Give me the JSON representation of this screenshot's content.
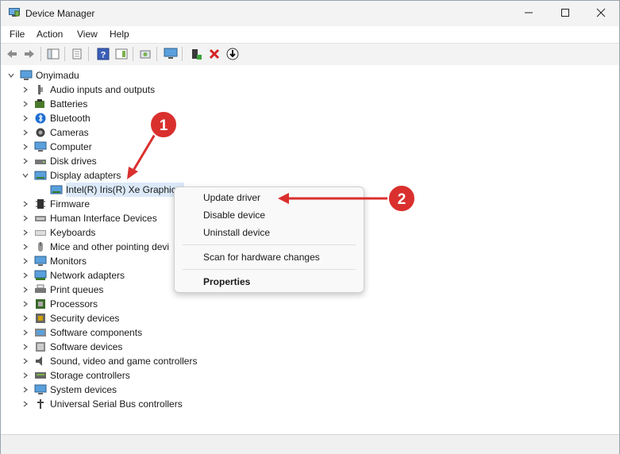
{
  "window": {
    "title": "Device Manager",
    "minimize": "—",
    "maximize": "☐",
    "close": "✕"
  },
  "menu": [
    "File",
    "Action",
    "View",
    "Help"
  ],
  "tree": {
    "root": "Onyimadu",
    "categories": [
      {
        "label": "Audio inputs and outputs",
        "icon": "speaker-icon"
      },
      {
        "label": "Batteries",
        "icon": "battery-icon"
      },
      {
        "label": "Bluetooth",
        "icon": "bluetooth-icon"
      },
      {
        "label": "Cameras",
        "icon": "camera-icon"
      },
      {
        "label": "Computer",
        "icon": "computer-icon"
      },
      {
        "label": "Disk drives",
        "icon": "disk-drive-icon"
      },
      {
        "label": "Display adapters",
        "icon": "display-adapter-icon",
        "expanded": true
      },
      {
        "label": "Intel(R) Iris(R) Xe Graphics",
        "icon": "display-adapter-icon",
        "child": true
      },
      {
        "label": "Firmware",
        "icon": "firmware-icon"
      },
      {
        "label": "Human Interface Devices",
        "icon": "hid-icon"
      },
      {
        "label": "Keyboards",
        "icon": "keyboard-icon"
      },
      {
        "label": "Mice and other pointing devi",
        "icon": "mouse-icon"
      },
      {
        "label": "Monitors",
        "icon": "monitor-icon"
      },
      {
        "label": "Network adapters",
        "icon": "network-adapter-icon"
      },
      {
        "label": "Print queues",
        "icon": "printer-icon"
      },
      {
        "label": "Processors",
        "icon": "processor-icon"
      },
      {
        "label": "Security devices",
        "icon": "security-device-icon"
      },
      {
        "label": "Software components",
        "icon": "software-component-icon"
      },
      {
        "label": "Software devices",
        "icon": "software-device-icon"
      },
      {
        "label": "Sound, video and game controllers",
        "icon": "sound-controller-icon"
      },
      {
        "label": "Storage controllers",
        "icon": "storage-controller-icon"
      },
      {
        "label": "System devices",
        "icon": "system-device-icon"
      },
      {
        "label": "Universal Serial Bus controllers",
        "icon": "usb-icon"
      }
    ]
  },
  "context_menu": {
    "update": "Update driver",
    "disable": "Disable device",
    "uninstall": "Uninstall device",
    "scan": "Scan for hardware changes",
    "properties": "Properties"
  },
  "annotations": {
    "first": "1",
    "second": "2",
    "color": "#d9302e"
  }
}
